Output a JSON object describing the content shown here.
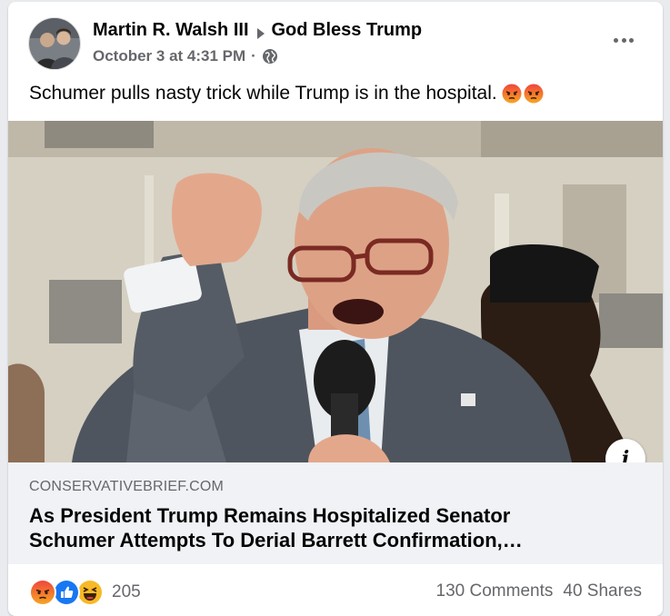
{
  "post": {
    "author": "Martin R. Walsh III",
    "group": "God Bless Trump",
    "timestamp": "October 3 at 4:31 PM",
    "separator": "·",
    "audience_icon": "globe-icon",
    "text": "Schumer pulls nasty trick while Trump is in the hospital.",
    "text_emojis": [
      "angry-emoji",
      "angry-emoji"
    ]
  },
  "link": {
    "domain": "CONSERVATIVEBRIEF.COM",
    "title_line1": "As President Trump Remains Hospitalized Senator",
    "title_line2": "Schumer Attempts To Derial Barrett Confirmation,…",
    "info_label": "i"
  },
  "engagement": {
    "reaction_icons": [
      "angry-react",
      "like-react",
      "haha-react"
    ],
    "reaction_count": "205",
    "comments": "130 Comments",
    "shares": "40 Shares"
  },
  "colors": {
    "card_bg": "#ffffff",
    "page_bg": "#e9ebee",
    "secondary_text": "#65676b",
    "like_blue": "#1877f2",
    "angry_orange": "#e9710f",
    "haha_yellow": "#f7b928"
  }
}
